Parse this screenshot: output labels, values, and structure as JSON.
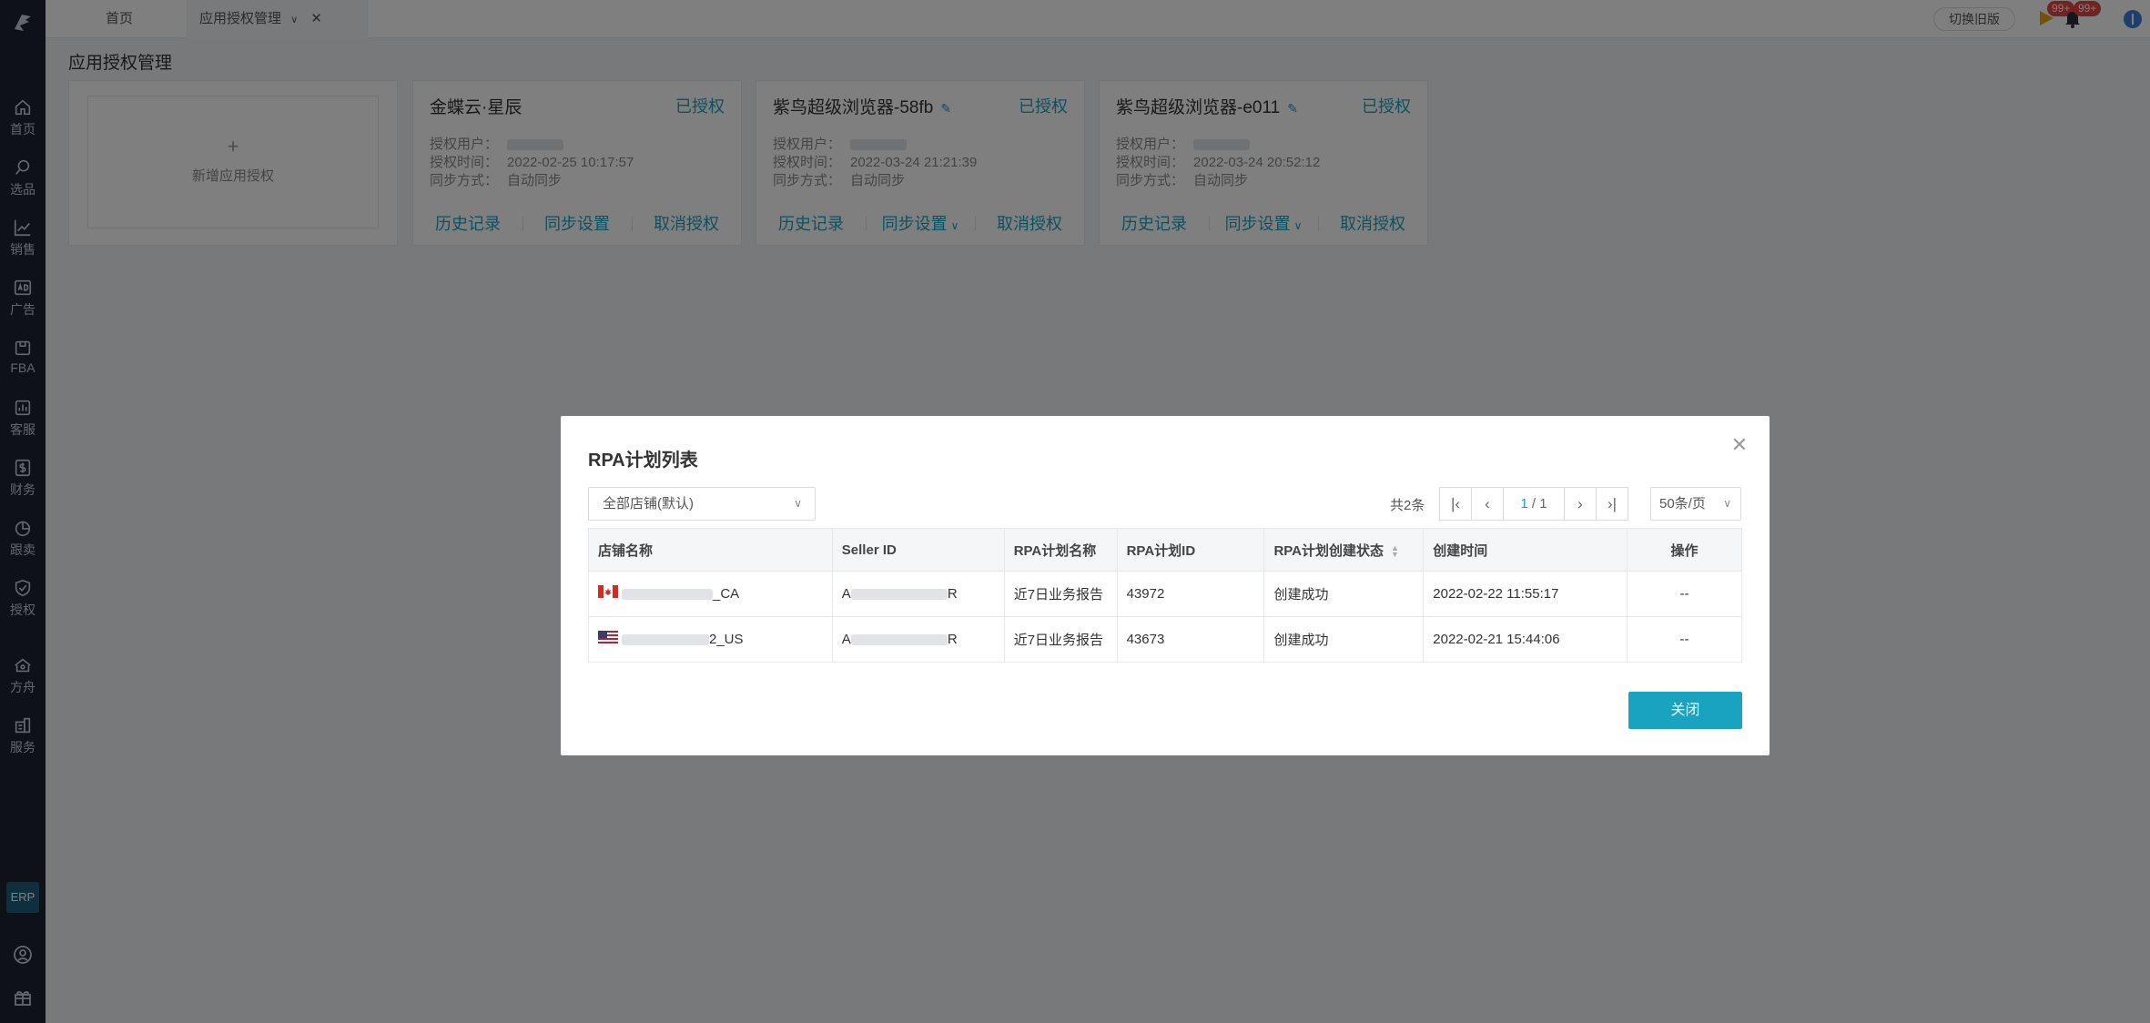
{
  "sidebar": {
    "items": [
      {
        "label": "首页",
        "icon": "home-icon"
      },
      {
        "label": "选品",
        "icon": "search-icon"
      },
      {
        "label": "销售",
        "icon": "trend-chart-icon"
      },
      {
        "label": "广告",
        "icon": "ad-icon"
      },
      {
        "label": "FBA",
        "icon": "package-icon"
      },
      {
        "label": "客服",
        "icon": "report-icon"
      },
      {
        "label": "财务",
        "icon": "dollar-icon"
      },
      {
        "label": "跟卖",
        "icon": "pie-chart-icon"
      },
      {
        "label": "授权",
        "icon": "shield-icon"
      },
      {
        "label": "方舟",
        "icon": "ark-icon"
      },
      {
        "label": "服务",
        "icon": "building-icon"
      }
    ],
    "erp_label": "ERP"
  },
  "topbar": {
    "tabs": [
      {
        "label": "首页"
      },
      {
        "label": "应用授权管理"
      }
    ],
    "switch_old_label": "切换旧版",
    "notification_badge_1": "99+",
    "notification_badge_2": "99+"
  },
  "page": {
    "title": "应用授权管理",
    "add_card_label": "新增应用授权",
    "add_card_plus": "+",
    "meta_labels": {
      "user": "授权用户：",
      "time": "授权时间：",
      "sync": "同步方式："
    },
    "cards": [
      {
        "name": "金蝶云·星辰",
        "status": "已授权",
        "time": "2022-02-25 10:17:57",
        "sync": "自动同步",
        "actions": [
          "历史记录",
          "同步设置",
          "取消授权"
        ],
        "editable": false
      },
      {
        "name": "紫鸟超级浏览器-58fb",
        "status": "已授权",
        "time": "2022-03-24 21:21:39",
        "sync": "自动同步",
        "actions": [
          "历史记录",
          "同步设置",
          "取消授权"
        ],
        "editable": true
      },
      {
        "name": "紫鸟超级浏览器-e011",
        "status": "已授权",
        "time": "2022-03-24 20:52:12",
        "sync": "自动同步",
        "actions": [
          "历史记录",
          "同步设置",
          "取消授权"
        ],
        "editable": true
      }
    ]
  },
  "modal": {
    "title": "RPA计划列表",
    "store_filter": "全部店铺(默认)",
    "total": "共2条",
    "pager": {
      "current": "1",
      "total_pages": "/ 1"
    },
    "page_size": "50条/页",
    "columns": [
      "店铺名称",
      "Seller ID",
      "RPA计划名称",
      "RPA计划ID",
      "RPA计划创建状态",
      "创建时间",
      "操作"
    ],
    "rows": [
      {
        "store_suffix": "_CA",
        "flag": "ca-flag-icon",
        "seller_prefix": "A",
        "seller_suffix": "R",
        "plan_name": "近7日业务报告",
        "plan_id": "43972",
        "status": "创建成功",
        "created": "2022-02-22 11:55:17",
        "action": "--"
      },
      {
        "store_suffix": "2_US",
        "flag": "us-flag-icon",
        "seller_prefix": "A",
        "seller_suffix": "R",
        "plan_name": "近7日业务报告",
        "plan_id": "43673",
        "status": "创建成功",
        "created": "2022-02-21 15:44:06",
        "action": "--"
      }
    ],
    "close_button": "关闭"
  },
  "colors": {
    "accent": "#1aa3c1",
    "sidebar_bg": "#1c2530",
    "overlay": "rgba(0,0,0,0.5)"
  }
}
